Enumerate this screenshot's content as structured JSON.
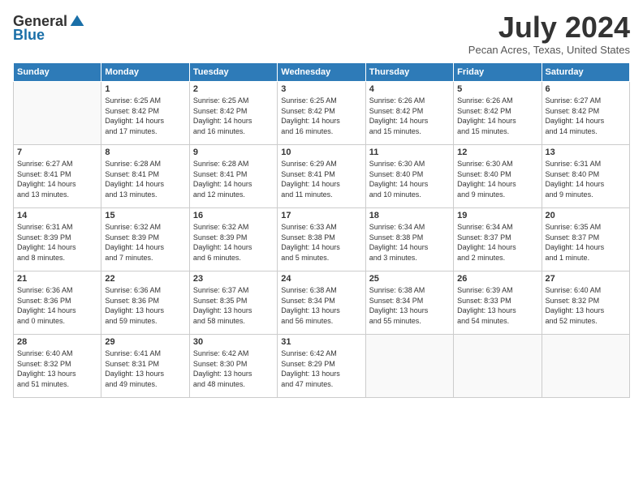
{
  "header": {
    "logo_general": "General",
    "logo_blue": "Blue",
    "title": "July 2024",
    "location": "Pecan Acres, Texas, United States"
  },
  "days_of_week": [
    "Sunday",
    "Monday",
    "Tuesday",
    "Wednesday",
    "Thursday",
    "Friday",
    "Saturday"
  ],
  "weeks": [
    [
      {
        "day": "",
        "info": ""
      },
      {
        "day": "1",
        "info": "Sunrise: 6:25 AM\nSunset: 8:42 PM\nDaylight: 14 hours\nand 17 minutes."
      },
      {
        "day": "2",
        "info": "Sunrise: 6:25 AM\nSunset: 8:42 PM\nDaylight: 14 hours\nand 16 minutes."
      },
      {
        "day": "3",
        "info": "Sunrise: 6:25 AM\nSunset: 8:42 PM\nDaylight: 14 hours\nand 16 minutes."
      },
      {
        "day": "4",
        "info": "Sunrise: 6:26 AM\nSunset: 8:42 PM\nDaylight: 14 hours\nand 15 minutes."
      },
      {
        "day": "5",
        "info": "Sunrise: 6:26 AM\nSunset: 8:42 PM\nDaylight: 14 hours\nand 15 minutes."
      },
      {
        "day": "6",
        "info": "Sunrise: 6:27 AM\nSunset: 8:42 PM\nDaylight: 14 hours\nand 14 minutes."
      }
    ],
    [
      {
        "day": "7",
        "info": "Sunrise: 6:27 AM\nSunset: 8:41 PM\nDaylight: 14 hours\nand 13 minutes."
      },
      {
        "day": "8",
        "info": "Sunrise: 6:28 AM\nSunset: 8:41 PM\nDaylight: 14 hours\nand 13 minutes."
      },
      {
        "day": "9",
        "info": "Sunrise: 6:28 AM\nSunset: 8:41 PM\nDaylight: 14 hours\nand 12 minutes."
      },
      {
        "day": "10",
        "info": "Sunrise: 6:29 AM\nSunset: 8:41 PM\nDaylight: 14 hours\nand 11 minutes."
      },
      {
        "day": "11",
        "info": "Sunrise: 6:30 AM\nSunset: 8:40 PM\nDaylight: 14 hours\nand 10 minutes."
      },
      {
        "day": "12",
        "info": "Sunrise: 6:30 AM\nSunset: 8:40 PM\nDaylight: 14 hours\nand 9 minutes."
      },
      {
        "day": "13",
        "info": "Sunrise: 6:31 AM\nSunset: 8:40 PM\nDaylight: 14 hours\nand 9 minutes."
      }
    ],
    [
      {
        "day": "14",
        "info": "Sunrise: 6:31 AM\nSunset: 8:39 PM\nDaylight: 14 hours\nand 8 minutes."
      },
      {
        "day": "15",
        "info": "Sunrise: 6:32 AM\nSunset: 8:39 PM\nDaylight: 14 hours\nand 7 minutes."
      },
      {
        "day": "16",
        "info": "Sunrise: 6:32 AM\nSunset: 8:39 PM\nDaylight: 14 hours\nand 6 minutes."
      },
      {
        "day": "17",
        "info": "Sunrise: 6:33 AM\nSunset: 8:38 PM\nDaylight: 14 hours\nand 5 minutes."
      },
      {
        "day": "18",
        "info": "Sunrise: 6:34 AM\nSunset: 8:38 PM\nDaylight: 14 hours\nand 3 minutes."
      },
      {
        "day": "19",
        "info": "Sunrise: 6:34 AM\nSunset: 8:37 PM\nDaylight: 14 hours\nand 2 minutes."
      },
      {
        "day": "20",
        "info": "Sunrise: 6:35 AM\nSunset: 8:37 PM\nDaylight: 14 hours\nand 1 minute."
      }
    ],
    [
      {
        "day": "21",
        "info": "Sunrise: 6:36 AM\nSunset: 8:36 PM\nDaylight: 14 hours\nand 0 minutes."
      },
      {
        "day": "22",
        "info": "Sunrise: 6:36 AM\nSunset: 8:36 PM\nDaylight: 13 hours\nand 59 minutes."
      },
      {
        "day": "23",
        "info": "Sunrise: 6:37 AM\nSunset: 8:35 PM\nDaylight: 13 hours\nand 58 minutes."
      },
      {
        "day": "24",
        "info": "Sunrise: 6:38 AM\nSunset: 8:34 PM\nDaylight: 13 hours\nand 56 minutes."
      },
      {
        "day": "25",
        "info": "Sunrise: 6:38 AM\nSunset: 8:34 PM\nDaylight: 13 hours\nand 55 minutes."
      },
      {
        "day": "26",
        "info": "Sunrise: 6:39 AM\nSunset: 8:33 PM\nDaylight: 13 hours\nand 54 minutes."
      },
      {
        "day": "27",
        "info": "Sunrise: 6:40 AM\nSunset: 8:32 PM\nDaylight: 13 hours\nand 52 minutes."
      }
    ],
    [
      {
        "day": "28",
        "info": "Sunrise: 6:40 AM\nSunset: 8:32 PM\nDaylight: 13 hours\nand 51 minutes."
      },
      {
        "day": "29",
        "info": "Sunrise: 6:41 AM\nSunset: 8:31 PM\nDaylight: 13 hours\nand 49 minutes."
      },
      {
        "day": "30",
        "info": "Sunrise: 6:42 AM\nSunset: 8:30 PM\nDaylight: 13 hours\nand 48 minutes."
      },
      {
        "day": "31",
        "info": "Sunrise: 6:42 AM\nSunset: 8:29 PM\nDaylight: 13 hours\nand 47 minutes."
      },
      {
        "day": "",
        "info": ""
      },
      {
        "day": "",
        "info": ""
      },
      {
        "day": "",
        "info": ""
      }
    ]
  ]
}
